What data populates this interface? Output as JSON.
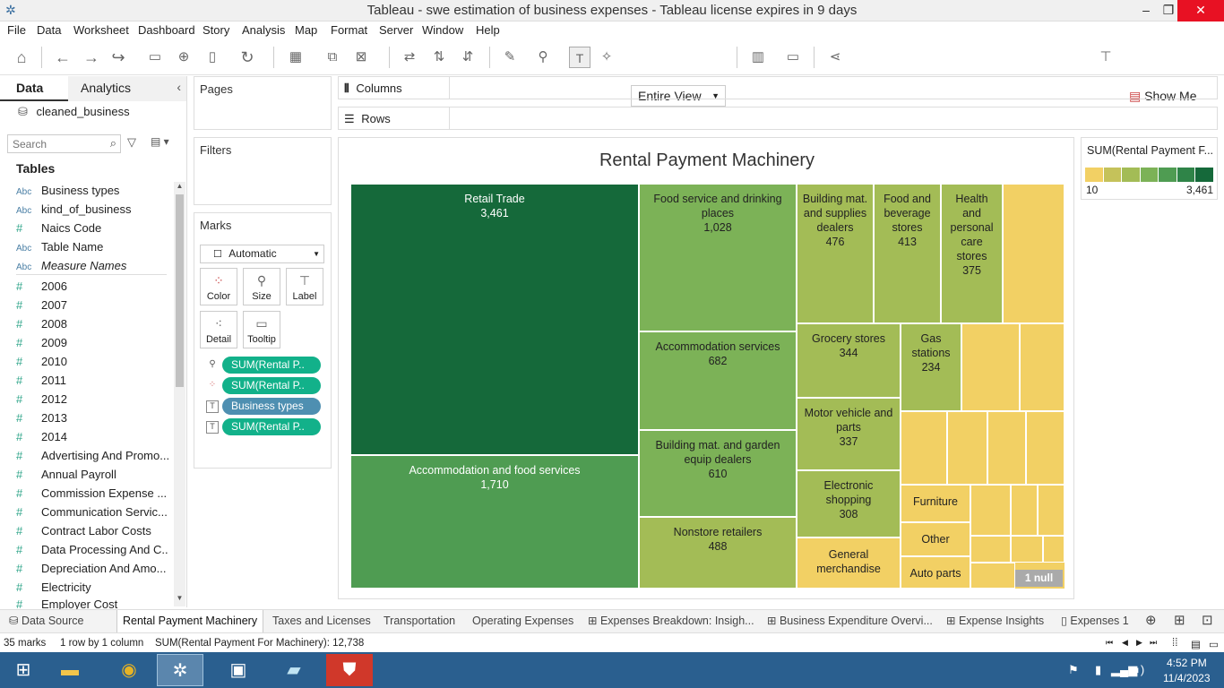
{
  "window": {
    "title": "Tableau - swe estimation of business expenses - Tableau license expires in 9 days",
    "min": "–",
    "max": "❐",
    "close": "✕"
  },
  "menu": [
    "File",
    "Data",
    "Worksheet",
    "Dashboard",
    "Story",
    "Analysis",
    "Map",
    "Format",
    "Server",
    "Window",
    "Help"
  ],
  "toolbar": {
    "fit_value": "Entire View",
    "show_me": "Show Me"
  },
  "leftpane": {
    "tab_data": "Data",
    "tab_analytics": "Analytics",
    "datasource": "cleaned_business",
    "search_placeholder": "Search",
    "tables_header": "Tables",
    "fields": [
      {
        "icon": "Abc",
        "name": "Business types"
      },
      {
        "icon": "Abc",
        "name": "kind_of_business"
      },
      {
        "icon": "#",
        "name": "Naics Code"
      },
      {
        "icon": "Abc",
        "name": "Table Name"
      },
      {
        "icon": "Abc",
        "name": "Measure Names"
      },
      {
        "icon": "#",
        "name": "2006"
      },
      {
        "icon": "#",
        "name": "2007"
      },
      {
        "icon": "#",
        "name": "2008"
      },
      {
        "icon": "#",
        "name": "2009"
      },
      {
        "icon": "#",
        "name": "2010"
      },
      {
        "icon": "#",
        "name": "2011"
      },
      {
        "icon": "#",
        "name": "2012"
      },
      {
        "icon": "#",
        "name": "2013"
      },
      {
        "icon": "#",
        "name": "2014"
      },
      {
        "icon": "#",
        "name": "Advertising And Promo..."
      },
      {
        "icon": "#",
        "name": "Annual Payroll"
      },
      {
        "icon": "#",
        "name": "Commission Expense ..."
      },
      {
        "icon": "#",
        "name": "Communication Servic..."
      },
      {
        "icon": "#",
        "name": "Contract Labor Costs"
      },
      {
        "icon": "#",
        "name": "Data Processing And C..."
      },
      {
        "icon": "#",
        "name": "Depreciation And Amo..."
      },
      {
        "icon": "#",
        "name": "Electricity"
      },
      {
        "icon": "#",
        "name": "Employer Cost"
      }
    ]
  },
  "shelves": {
    "pages": "Pages",
    "filters": "Filters",
    "marks": "Marks",
    "columns": "Columns",
    "rows": "Rows",
    "mark_type": "Automatic",
    "mark_buttons": [
      "Color",
      "Size",
      "Label",
      "Detail",
      "Tooltip"
    ],
    "pills": [
      "SUM(Rental P..",
      "SUM(Rental P..",
      "Business types",
      "SUM(Rental P.."
    ]
  },
  "legend": {
    "title": "SUM(Rental Payment F...",
    "min": "10",
    "max": "3,461",
    "colors": [
      "#f2d064",
      "#c5c25a",
      "#a3bc56",
      "#7cb257",
      "#4f9c52",
      "#2f8448",
      "#15693a"
    ]
  },
  "chart_data": {
    "type": "treemap",
    "title": "Rental Payment Machinery",
    "measure": "SUM(Rental Payment For Machinery)",
    "items": [
      {
        "label": "Retail Trade",
        "value": 3461,
        "value_label": "3,461"
      },
      {
        "label": "Accommodation and food services",
        "value": 1710,
        "value_label": "1,710"
      },
      {
        "label": "Food service and drinking places",
        "value": 1028,
        "value_label": "1,028"
      },
      {
        "label": "Accommodation services",
        "value": 682,
        "value_label": "682"
      },
      {
        "label": "Building mat. and garden equip dealers",
        "value": 610,
        "value_label": "610"
      },
      {
        "label": "Nonstore retailers",
        "value": 488,
        "value_label": "488"
      },
      {
        "label": "Building mat. and supplies dealers",
        "value": 476,
        "value_label": "476"
      },
      {
        "label": "Food and beverage stores",
        "value": 413,
        "value_label": "413"
      },
      {
        "label": "Health and personal care stores",
        "value": 375,
        "value_label": "375"
      },
      {
        "label": "Grocery stores",
        "value": 344,
        "value_label": "344"
      },
      {
        "label": "Motor vehicle and parts",
        "value": 337,
        "value_label": "337"
      },
      {
        "label": "Electronic shopping",
        "value": 308,
        "value_label": "308"
      },
      {
        "label": "Gas stations",
        "value": 234,
        "value_label": "234"
      },
      {
        "label": "General merchandise",
        "value_label": ""
      },
      {
        "label": "Furniture",
        "value_label": ""
      },
      {
        "label": "Other",
        "value_label": ""
      },
      {
        "label": "Auto parts",
        "value_label": ""
      }
    ],
    "null_badge": "1 null"
  },
  "sheet_tabs": [
    "Data Source",
    "Rental Payment Machinery",
    "Taxes and Licenses",
    "Transportation",
    "Operating Expenses",
    "Expenses Breakdown: Insigh...",
    "Business Expenditure Overvi...",
    "Expense Insights",
    "Expenses 1"
  ],
  "status": {
    "marks": "35 marks",
    "dims": "1 row by 1 column",
    "sum": "SUM(Rental Payment For Machinery): 12,738"
  },
  "taskbar": {
    "time": "4:52 PM",
    "date": "11/4/2023"
  }
}
